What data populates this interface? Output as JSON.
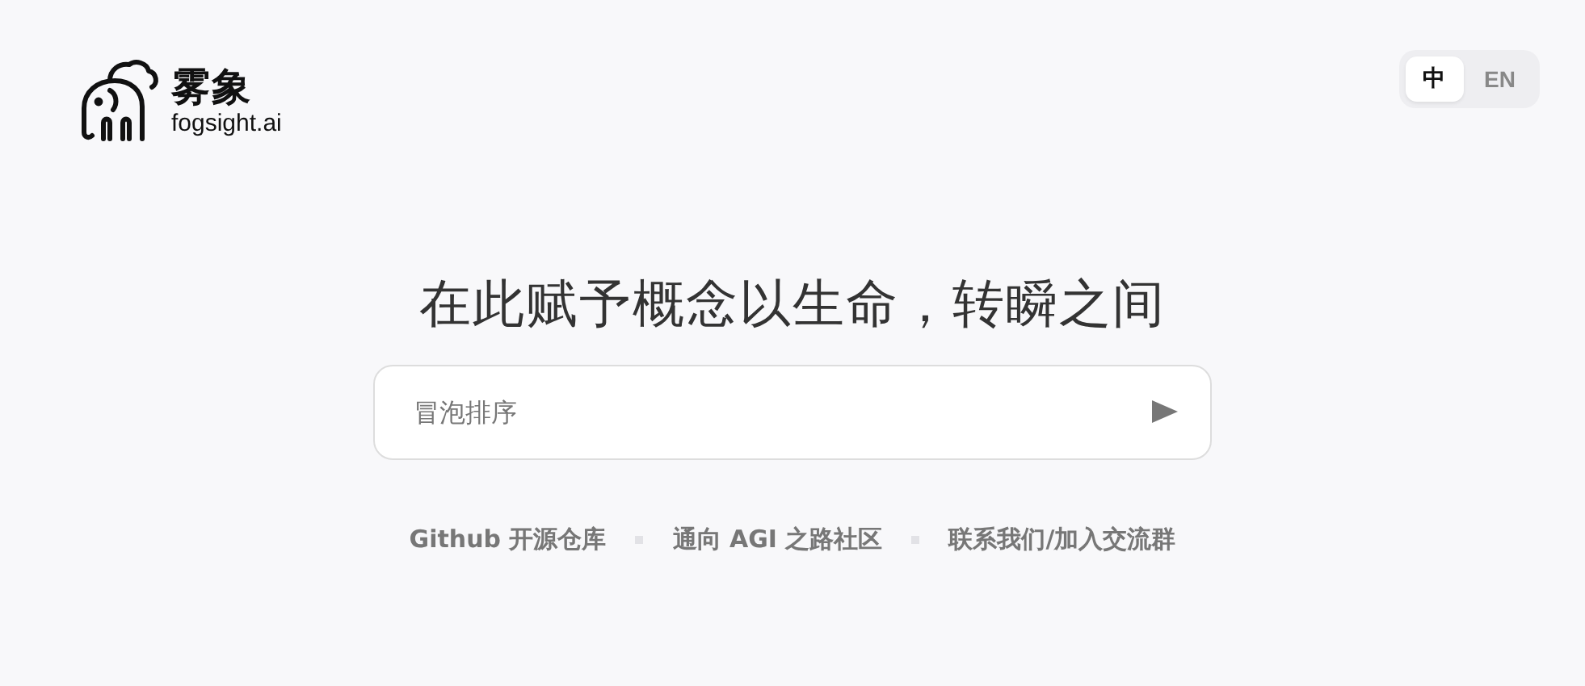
{
  "brand": {
    "name": "雾象",
    "domain": "fogsight.ai"
  },
  "language_toggle": [
    {
      "label": "中",
      "selected": true
    },
    {
      "label": "EN",
      "selected": false
    }
  ],
  "headline": "在此赋予概念以生命，转瞬之间",
  "prompt": {
    "placeholder": "冒泡排序"
  },
  "links": [
    {
      "label": "Github 开源仓库"
    },
    {
      "label": "通向 AGI 之路社区"
    },
    {
      "label": "联系我们/加入交流群"
    }
  ]
}
